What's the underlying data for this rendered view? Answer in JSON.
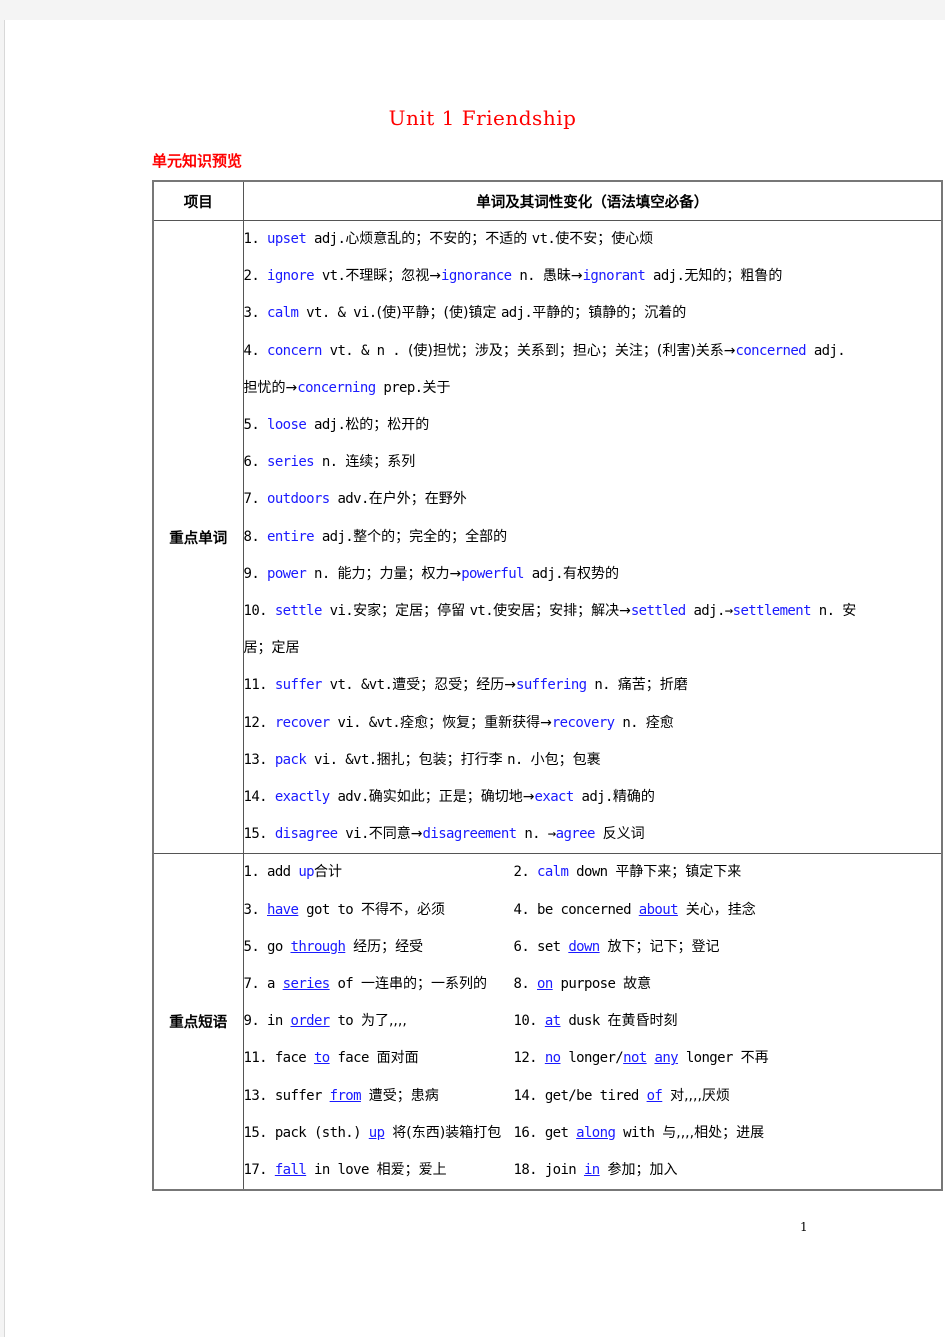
{
  "document": {
    "title": "Unit 1 Friendship",
    "section_label": "单元知识预览",
    "page_number": "1",
    "colors": {
      "heading": "#ff0000",
      "keyword": "#1a1aff"
    }
  },
  "table": {
    "headers": [
      "项目",
      "单词及其词性变化（语法填空必备）"
    ],
    "vocab_label": "重点单词",
    "phrases_label": "重点短语",
    "words": [
      [
        {
          "t": "1. "
        },
        {
          "t": "upset",
          "k": 1
        },
        {
          "t": " adj."
        },
        {
          "t": "心烦意乱的；不安的；不适的 ",
          "c": 1
        },
        {
          "t": "vt."
        },
        {
          "t": "使不安；使心烦",
          "c": 1
        }
      ],
      [
        {
          "t": "2. "
        },
        {
          "t": "ignore",
          "k": 1
        },
        {
          "t": " vt."
        },
        {
          "t": "不理睬；忽视→",
          "c": 1
        },
        {
          "t": "ignorance",
          "k": 1
        },
        {
          "t": " n. "
        },
        {
          "t": "愚昧→",
          "c": 1
        },
        {
          "t": "ignorant",
          "k": 1
        },
        {
          "t": " adj."
        },
        {
          "t": "无知的；粗鲁的",
          "c": 1
        }
      ],
      [
        {
          "t": "3. "
        },
        {
          "t": "calm",
          "k": 1
        },
        {
          "t": " vt. & vi."
        },
        {
          "t": "(使)平静；(使)镇定  ",
          "c": 1
        },
        {
          "t": "adj."
        },
        {
          "t": "平静的；镇静的；沉着的",
          "c": 1
        }
      ],
      [
        {
          "t": "4. "
        },
        {
          "t": "concern",
          "k": 1
        },
        {
          "t": " vt. & n . "
        },
        {
          "t": "(使)担忧；涉及；关系到；担心；关注；(利害)关系→",
          "c": 1
        },
        {
          "t": "concerned",
          "k": 1
        },
        {
          "t": " adj."
        }
      ],
      [
        {
          "t": "担忧的→",
          "c": 1
        },
        {
          "t": "concerning",
          "k": 1
        },
        {
          "t": " prep."
        },
        {
          "t": "关于",
          "c": 1
        }
      ],
      [
        {
          "t": "5. "
        },
        {
          "t": "loose",
          "k": 1
        },
        {
          "t": " adj."
        },
        {
          "t": "松的；松开的",
          "c": 1
        }
      ],
      [
        {
          "t": "6. "
        },
        {
          "t": "series",
          "k": 1
        },
        {
          "t": " n. "
        },
        {
          "t": "连续；系列",
          "c": 1
        }
      ],
      [
        {
          "t": "7. "
        },
        {
          "t": "outdoors",
          "k": 1
        },
        {
          "t": " adv."
        },
        {
          "t": "在户外；在野外",
          "c": 1
        }
      ],
      [
        {
          "t": "8. "
        },
        {
          "t": "entire",
          "k": 1
        },
        {
          "t": " adj."
        },
        {
          "t": "整个的；完全的；全部的",
          "c": 1
        }
      ],
      [
        {
          "t": "9. "
        },
        {
          "t": "power",
          "k": 1
        },
        {
          "t": " n. "
        },
        {
          "t": "能力；力量；权力→",
          "c": 1
        },
        {
          "t": "powerful",
          "k": 1
        },
        {
          "t": " adj."
        },
        {
          "t": "有权势的",
          "c": 1
        }
      ],
      [
        {
          "t": "10. "
        },
        {
          "t": "settle",
          "k": 1
        },
        {
          "t": " vi."
        },
        {
          "t": "安家；定居；停留 ",
          "c": 1
        },
        {
          "t": "vt."
        },
        {
          "t": "使安居；安排；解决→",
          "c": 1
        },
        {
          "t": "settled",
          "k": 1
        },
        {
          "t": " adj.→"
        },
        {
          "t": "settlement",
          "k": 1
        },
        {
          "t": " n. "
        },
        {
          "t": "安",
          "c": 1
        }
      ],
      [
        {
          "t": "居；定居",
          "c": 1
        }
      ],
      [
        {
          "t": "11. "
        },
        {
          "t": "suffer",
          "k": 1
        },
        {
          "t": " vt. &vt."
        },
        {
          "t": "遭受；忍受；经历→",
          "c": 1
        },
        {
          "t": "suffering",
          "k": 1
        },
        {
          "t": " n. "
        },
        {
          "t": "痛苦；折磨",
          "c": 1
        }
      ],
      [
        {
          "t": "12. "
        },
        {
          "t": "recover",
          "k": 1
        },
        {
          "t": " vi. &vt."
        },
        {
          "t": "痊愈；恢复；重新获得→",
          "c": 1
        },
        {
          "t": "recovery",
          "k": 1
        },
        {
          "t": " n. "
        },
        {
          "t": "痊愈",
          "c": 1
        }
      ],
      [
        {
          "t": "13. "
        },
        {
          "t": "pack",
          "k": 1
        },
        {
          "t": " vi. &vt."
        },
        {
          "t": "捆扎；包装；打行李 ",
          "c": 1
        },
        {
          "t": "n. "
        },
        {
          "t": "小包；包裹",
          "c": 1
        }
      ],
      [
        {
          "t": "14. "
        },
        {
          "t": "exactly",
          "k": 1
        },
        {
          "t": " adv."
        },
        {
          "t": "确实如此；正是；确切地→",
          "c": 1
        },
        {
          "t": "exact",
          "k": 1
        },
        {
          "t": " adj."
        },
        {
          "t": "精确的",
          "c": 1
        }
      ],
      [
        {
          "t": "15. "
        },
        {
          "t": "disagree",
          "k": 1
        },
        {
          "t": " vi."
        },
        {
          "t": "不同意→",
          "c": 1
        },
        {
          "t": "disagreement",
          "k": 1
        },
        {
          "t": " n. →"
        },
        {
          "t": "agree",
          "k": 1
        },
        {
          "t": "  "
        },
        {
          "t": "反义词",
          "c": 1
        }
      ]
    ],
    "phrases": [
      [
        [
          {
            "t": "1. add "
          },
          {
            "t": "up",
            "k": 1
          },
          {
            "t": "合计",
            "c": 1
          }
        ],
        [
          {
            "t": "2. "
          },
          {
            "t": "calm",
            "k": 1
          },
          {
            "t": " down  "
          },
          {
            "t": "平静下来；镇定下来",
            "c": 1
          }
        ]
      ],
      [
        [
          {
            "t": "3. "
          },
          {
            "t": "have",
            "u": 1
          },
          {
            "t": " got to  "
          },
          {
            "t": "不得不，必须",
            "c": 1
          }
        ],
        [
          {
            "t": "4. be concerned "
          },
          {
            "t": "about",
            "u": 1
          },
          {
            "t": "  "
          },
          {
            "t": "关心，挂念",
            "c": 1
          }
        ]
      ],
      [
        [
          {
            "t": "5. go "
          },
          {
            "t": "through",
            "u": 1
          },
          {
            "t": "  "
          },
          {
            "t": "经历；经受",
            "c": 1
          }
        ],
        [
          {
            "t": "6. set "
          },
          {
            "t": "down",
            "u": 1
          },
          {
            "t": "  "
          },
          {
            "t": "放下；记下；登记",
            "c": 1
          }
        ]
      ],
      [
        [
          {
            "t": "7. a "
          },
          {
            "t": "series",
            "u": 1
          },
          {
            "t": " of  "
          },
          {
            "t": "一连串的；一系列的",
            "c": 1
          }
        ],
        [
          {
            "t": "8. "
          },
          {
            "t": "on",
            "u": 1
          },
          {
            "t": " purpose  "
          },
          {
            "t": "故意",
            "c": 1
          }
        ]
      ],
      [
        [
          {
            "t": "9. in "
          },
          {
            "t": "order",
            "u": 1
          },
          {
            "t": " to  "
          },
          {
            "t": "为了,,,,",
            "c": 1
          }
        ],
        [
          {
            "t": "10.   "
          },
          {
            "t": "at",
            "u": 1
          },
          {
            "t": " dusk  "
          },
          {
            "t": "在黄昏时刻",
            "c": 1
          }
        ]
      ],
      [
        [
          {
            "t": "11. face "
          },
          {
            "t": "to",
            "u": 1
          },
          {
            "t": " face  "
          },
          {
            "t": "面对面",
            "c": 1
          }
        ],
        [
          {
            "t": "12. "
          },
          {
            "t": "no",
            "u": 1
          },
          {
            "t": " longer/"
          },
          {
            "t": "not",
            "u": 1
          },
          {
            "t": "  "
          },
          {
            "t": "any",
            "u": 1
          },
          {
            "t": " longer  "
          },
          {
            "t": "不再",
            "c": 1
          }
        ]
      ],
      [
        [
          {
            "t": "13. suffer "
          },
          {
            "t": "from",
            "u": 1
          },
          {
            "t": "  "
          },
          {
            "t": "遭受；患病",
            "c": 1
          }
        ],
        [
          {
            "t": "14. get/be tired "
          },
          {
            "t": "of",
            "u": 1
          },
          {
            "t": "  "
          },
          {
            "t": "对,,,,厌烦",
            "c": 1
          }
        ]
      ],
      [
        [
          {
            "t": "15. pack (sth.) "
          },
          {
            "t": "up",
            "u": 1
          },
          {
            "t": "  "
          },
          {
            "t": "将(东西)装箱打包",
            "c": 1
          }
        ],
        [
          {
            "t": "16. get "
          },
          {
            "t": "along",
            "u": 1
          },
          {
            "t": " with  "
          },
          {
            "t": "与,,,,相处；进展",
            "c": 1
          }
        ]
      ],
      [
        [
          {
            "t": "17. "
          },
          {
            "t": "fall",
            "u": 1
          },
          {
            "t": " in love  "
          },
          {
            "t": "相爱；爱上",
            "c": 1
          }
        ],
        [
          {
            "t": "18. join "
          },
          {
            "t": "in",
            "u": 1
          },
          {
            "t": "  "
          },
          {
            "t": "参加；加入",
            "c": 1
          }
        ]
      ]
    ]
  }
}
